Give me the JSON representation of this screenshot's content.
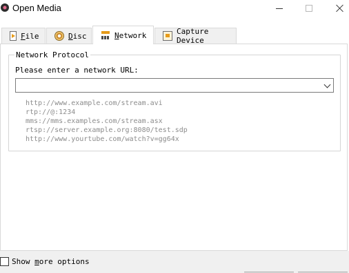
{
  "window": {
    "title": "Open Media",
    "controls": [
      "minimize",
      "maximize",
      "close"
    ]
  },
  "tabs": [
    {
      "label_accel": "F",
      "label_rest": "ile",
      "icon": "file-icon",
      "active": false
    },
    {
      "label_accel": "D",
      "label_rest": "isc",
      "icon": "disc-icon",
      "active": false
    },
    {
      "label_accel": "N",
      "label_rest": "etwork",
      "icon": "network-icon",
      "active": true
    },
    {
      "label_pre": "Capture ",
      "label_accel": "D",
      "label_rest": "evice",
      "icon": "capture-device-icon",
      "active": false
    }
  ],
  "network": {
    "group_title": "Network Protocol",
    "url_label": "Please enter a network URL:",
    "url_value": "",
    "examples": [
      "http://www.example.com/stream.avi",
      "rtp://@:1234",
      "mms://mms.examples.com/stream.asx",
      "rtsp://server.example.org:8080/test.sdp",
      "http://www.yourtube.com/watch?v=gg64x"
    ]
  },
  "options": {
    "show_more_pre": "Show ",
    "show_more_accel": "m",
    "show_more_rest": "ore options",
    "checked": false
  },
  "colors": {
    "example_text": "#8c8c8c",
    "bottom_bar": "#f0f0f0",
    "accent_orange": "#e79b18"
  }
}
